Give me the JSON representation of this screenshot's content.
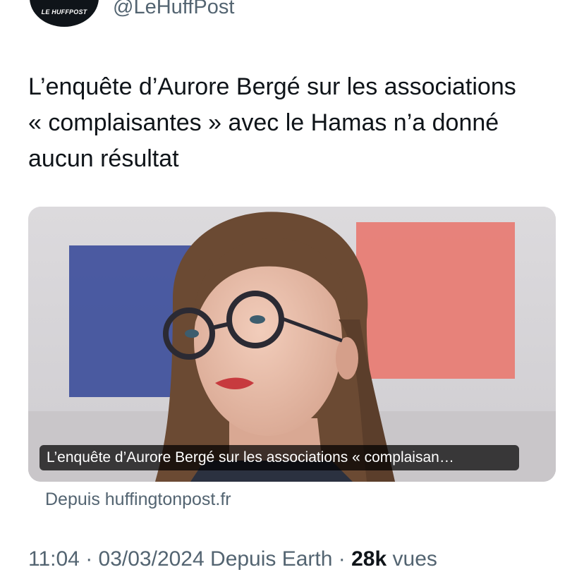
{
  "author": {
    "logo_text": "LE HUFFPOST",
    "handle": "@LeHuffPost"
  },
  "tweet": {
    "text": "L’enquête d’Aurore Bergé sur les associations « complaisantes » avec le Hamas n’a donné aucun résultat"
  },
  "card": {
    "caption": "L’enquête d’Aurore Bergé sur les associations « complaisan…",
    "source": "Depuis huffingtonpost.fr",
    "colors": {
      "flag_blue": "#3b4c9a",
      "flag_red": "#e87b72",
      "lips": "#c73a3e",
      "hair": "#6b4a33"
    }
  },
  "meta": {
    "time": "11:04",
    "separator1": " · ",
    "date": "03/03/2024",
    "client": " Depuis Earth",
    "separator2": " · ",
    "views_count": "28k",
    "views_label": " vues"
  },
  "colors": {
    "text": "#0f1419",
    "secondary": "#536471",
    "brand_green": "#2ad39a"
  }
}
